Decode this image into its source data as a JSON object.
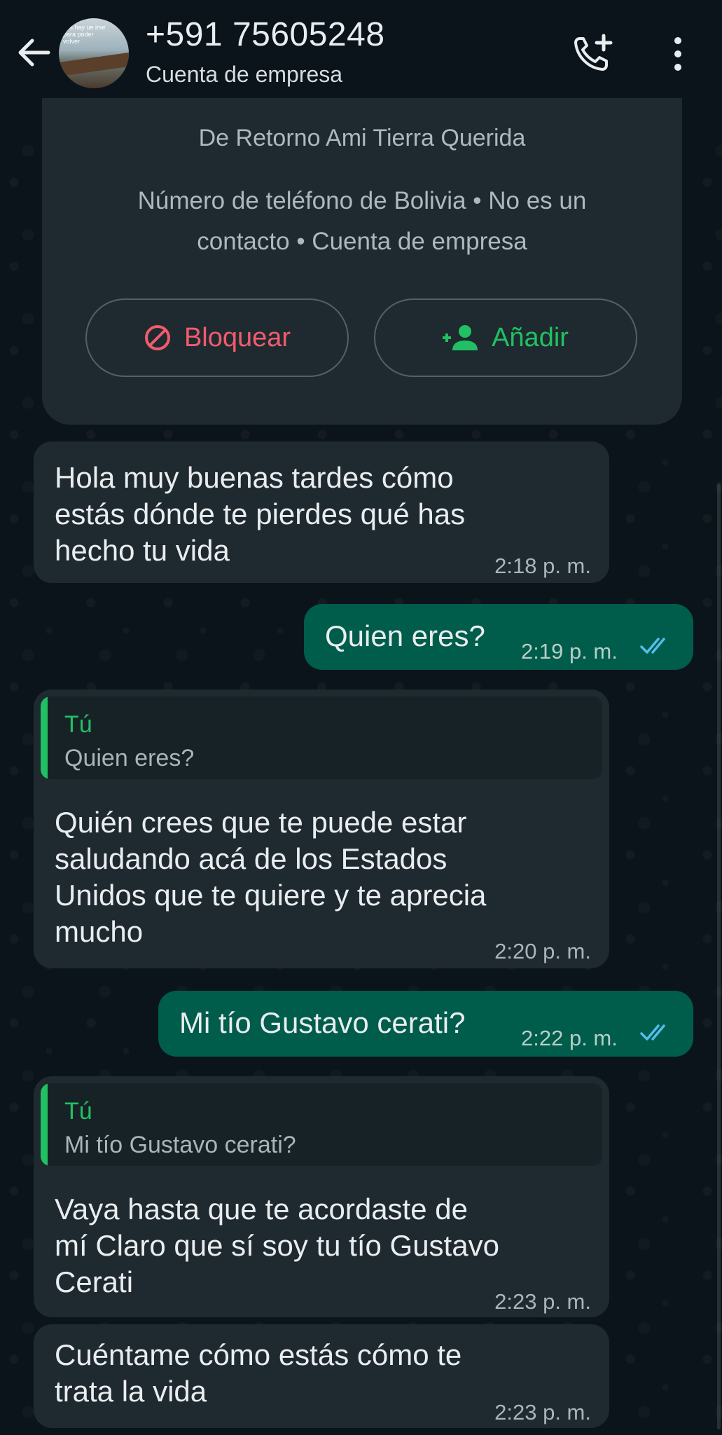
{
  "header": {
    "title": "+591 75605248",
    "subtitle": "Cuenta de empresa",
    "avatar_text": "ces hay ue irse para poder volver"
  },
  "info_card": {
    "name": "De Retorno Ami Tierra Querida",
    "description": "Número de teléfono de Bolivia • No es un contacto • Cuenta de empresa",
    "block_label": "Bloquear",
    "add_label": "Añadir"
  },
  "messages": [
    {
      "direction": "in",
      "lines": [
        "Hola muy buenas tardes cómo",
        "estás dónde te pierdes qué has",
        "hecho tu vida"
      ],
      "time": "2:18 p. m."
    },
    {
      "direction": "out",
      "lines": [
        "Quien eres?"
      ],
      "time": "2:19 p. m.",
      "status": "read"
    },
    {
      "direction": "in",
      "quote": {
        "author": "Tú",
        "text": "Quien eres?"
      },
      "lines": [
        "Quién crees que te puede estar",
        "saludando acá de los Estados",
        "Unidos que te quiere y te aprecia",
        "mucho"
      ],
      "time": "2:20 p. m."
    },
    {
      "direction": "out",
      "lines": [
        "Mi tío Gustavo cerati?"
      ],
      "time": "2:22 p. m.",
      "status": "read"
    },
    {
      "direction": "in",
      "quote": {
        "author": "Tú",
        "text": "Mi tío Gustavo cerati?"
      },
      "lines": [
        "Vaya hasta que te acordaste de",
        "mí Claro que sí soy tu tío Gustavo",
        "Cerati"
      ],
      "time": "2:23 p. m."
    },
    {
      "direction": "in",
      "lines": [
        "Cuéntame cómo estás cómo te",
        "trata la vida"
      ],
      "time": "2:23 p. m."
    }
  ],
  "colors": {
    "background": "#0b141a",
    "incoming_bubble": "#1f2a30",
    "outgoing_bubble": "#005c4b",
    "accent_green": "#21c063",
    "danger_red": "#f15c6d",
    "read_ticks": "#53bdeb"
  },
  "icons": {
    "back": "arrow-left-icon",
    "call": "add-call-icon",
    "menu": "more-vert-icon",
    "block": "block-icon",
    "add": "person-add-icon",
    "read": "double-check-icon"
  }
}
